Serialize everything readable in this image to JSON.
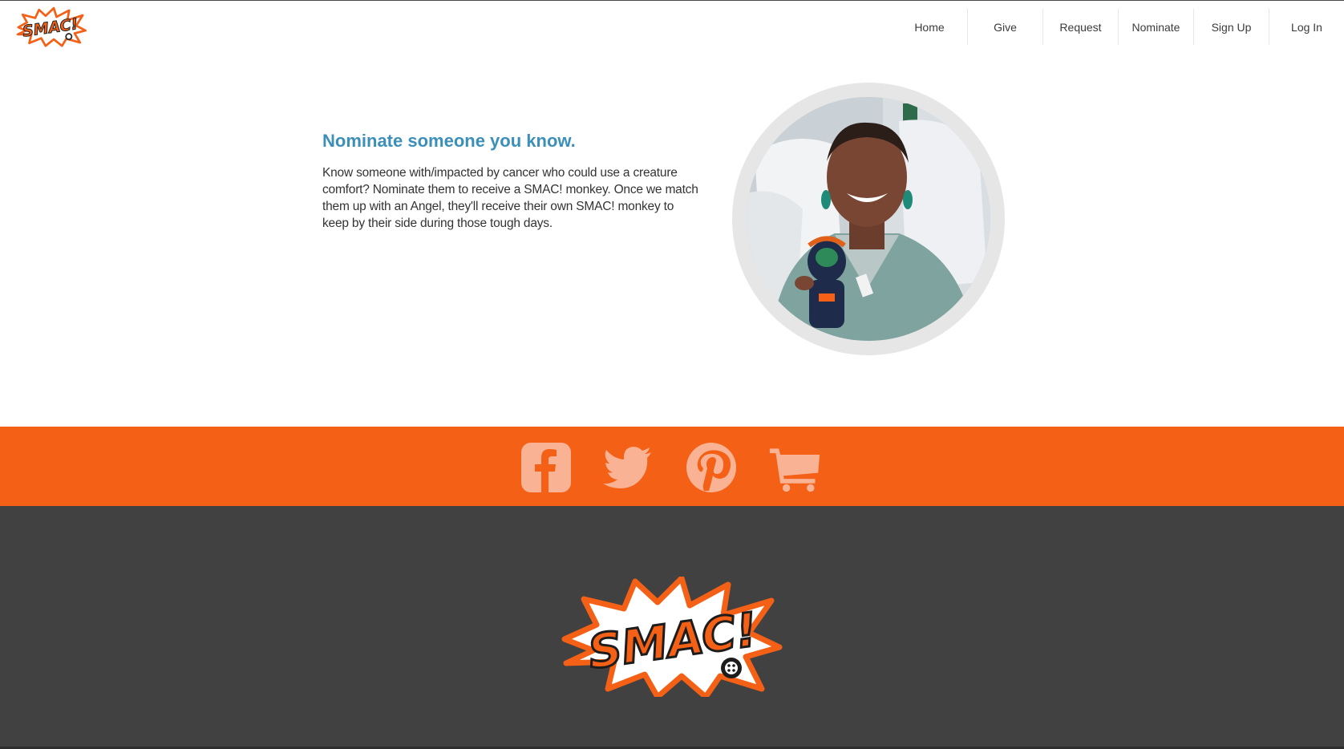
{
  "brand": {
    "name": "SMAC!",
    "colors": {
      "orange": "#f46116",
      "title_blue": "#3b8fb8",
      "footer_gray": "#414141"
    }
  },
  "nav": {
    "items": [
      {
        "label": "Home",
        "name": "nav-home"
      },
      {
        "label": "Give",
        "name": "nav-give"
      },
      {
        "label": "Request",
        "name": "nav-request"
      },
      {
        "label": "Nominate",
        "name": "nav-nominate"
      },
      {
        "label": "Sign Up",
        "name": "nav-sign-up"
      },
      {
        "label": "Log In",
        "name": "nav-log-in"
      }
    ]
  },
  "hero": {
    "title": "Nominate someone you know.",
    "body": "Know someone with/impacted by cancer who could use a creature comfort? Nominate them to receive a SMAC! monkey. Once we match them up with an Angel, they'll receive their own SMAC! monkey to keep by their side during those tough days."
  },
  "social": {
    "icons": [
      "facebook-icon",
      "twitter-icon",
      "pinterest-icon",
      "shopping-cart-icon"
    ]
  }
}
